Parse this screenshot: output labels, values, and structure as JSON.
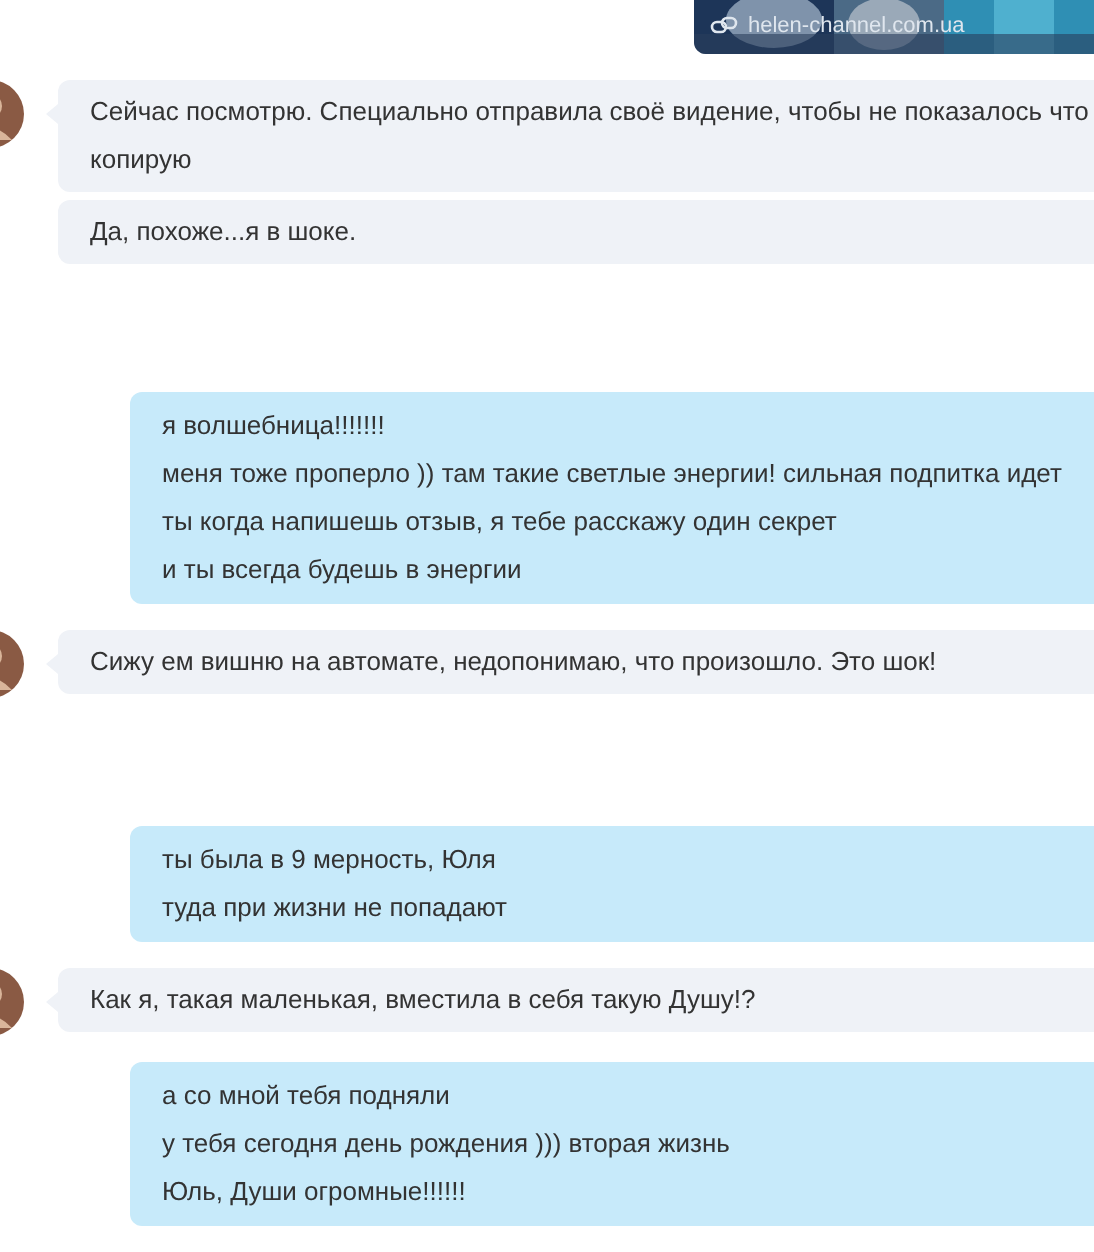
{
  "messages": [
    {
      "kind": "link_preview",
      "url": "helen-channel.com.ua"
    },
    {
      "kind": "received",
      "show_avatar": true,
      "lines": [
        "Сейчас посмотрю. Специально отправила своё видение, чтобы не показалось что копирую"
      ]
    },
    {
      "kind": "received",
      "show_avatar": false,
      "lines": [
        "Да, похоже...я в шоке."
      ]
    },
    {
      "kind": "sent",
      "new_group": true,
      "lines": [
        "я волшебница!!!!!!!",
        "меня тоже проперло )) там такие светлые энергии! сильная подпитка идет",
        "ты когда напишешь отзыв, я тебе расскажу один секрет",
        "и ты всегда будешь в энергии"
      ]
    },
    {
      "kind": "received",
      "show_avatar": true,
      "lines": [
        "Сижу ем вишню на автомате, недопонимаю, что произошло. Это шок!"
      ]
    },
    {
      "kind": "sent",
      "new_group": true,
      "lines": [
        "ты была в 9 мерность, Юля",
        "туда при жизни не попадают"
      ]
    },
    {
      "kind": "received",
      "show_avatar": true,
      "lines": [
        "Как я, такая маленькая, вместила в себя такую Душу!?"
      ]
    },
    {
      "kind": "sent",
      "new_group": false,
      "lines": [
        "а со мной тебя подняли",
        "у тебя сегодня день рождения ))) вторая жизнь",
        "Юль, Души огромные!!!!!!"
      ]
    }
  ]
}
